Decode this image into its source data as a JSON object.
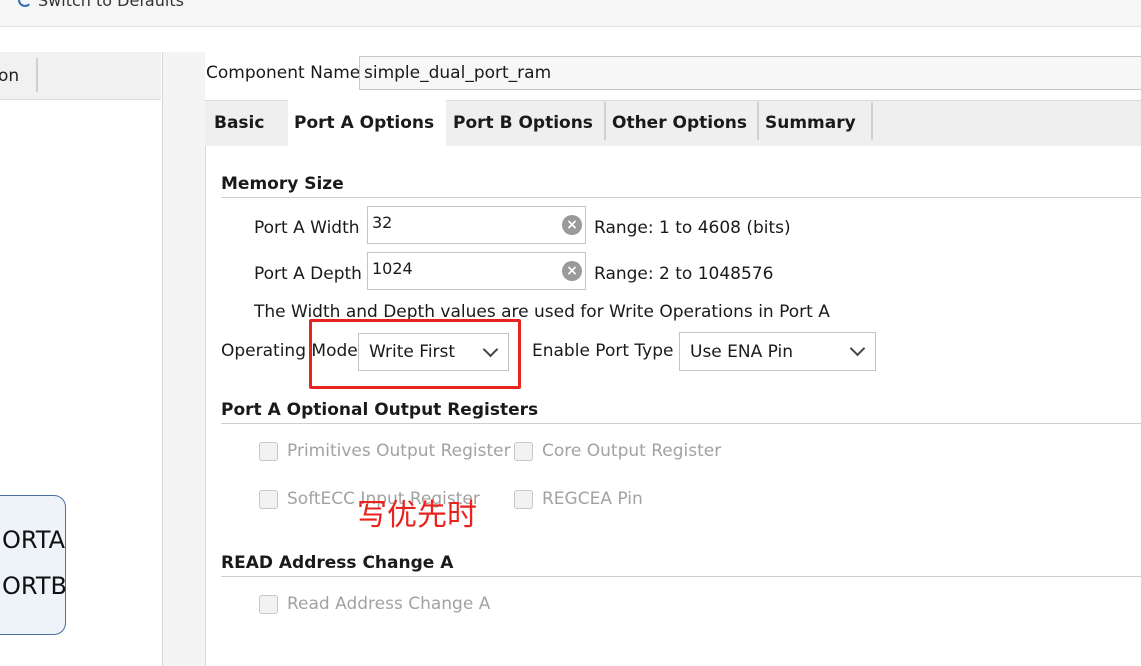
{
  "toolbar": {
    "defaults_label": "Switch to Defaults"
  },
  "left_panel": {
    "tab_label": "on",
    "ports": [
      "ORTA",
      "ORTB"
    ]
  },
  "component": {
    "label": "Component Name",
    "value": "simple_dual_port_ram"
  },
  "tabs": [
    "Basic",
    "Port A Options",
    "Port B Options",
    "Other Options",
    "Summary"
  ],
  "memory_size": {
    "title": "Memory Size",
    "width_label": "Port A Width",
    "width_value": "32",
    "width_range": "Range: 1 to 4608 (bits)",
    "depth_label": "Port A Depth",
    "depth_value": "1024",
    "depth_range": "Range: 2 to 1048576",
    "note": "The Width and Depth values are used for Write Operations in Port A"
  },
  "operating_mode": {
    "label": "Operating Mode",
    "value": "Write First"
  },
  "enable_port_type": {
    "label": "Enable Port Type",
    "value": "Use ENA Pin"
  },
  "output_registers": {
    "title": "Port A Optional Output Registers",
    "primitives": "Primitives Output Register",
    "core": "Core Output Register",
    "softecc": "SoftECC Input Register",
    "regcea": "REGCEA Pin"
  },
  "read_address": {
    "title": "READ Address Change A",
    "option": "Read Address Change A"
  },
  "annotation": {
    "text": "写优先时",
    "color": "#e8231e"
  },
  "colors": {
    "highlight": "#e8231e",
    "symbol_border": "#4a6fa0"
  }
}
